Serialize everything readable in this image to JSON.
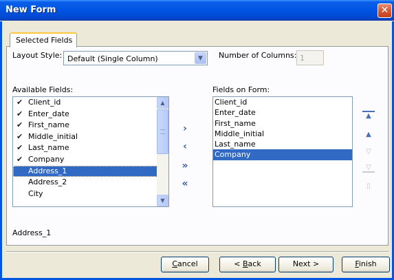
{
  "window": {
    "title": "New Form",
    "close_glyph": "✕"
  },
  "tabs": [
    {
      "label": "Selected Fields"
    }
  ],
  "layout_style": {
    "label": "Layout Style:",
    "value": "Default (Single Column)"
  },
  "number_of_columns": {
    "label": "Number of Columns:",
    "value": "1"
  },
  "available_fields": {
    "label": "Available Fields:",
    "items": [
      {
        "label": "Client_id",
        "checked": true
      },
      {
        "label": "Enter_date",
        "checked": true
      },
      {
        "label": "First_name",
        "checked": true
      },
      {
        "label": "Middle_initial",
        "checked": true
      },
      {
        "label": "Last_name",
        "checked": true
      },
      {
        "label": "Company",
        "checked": true
      },
      {
        "label": "Address_1",
        "checked": false,
        "selected": true
      },
      {
        "label": "Address_2",
        "checked": false
      },
      {
        "label": "City",
        "checked": false
      }
    ]
  },
  "fields_on_form": {
    "label": "Fields on Form:",
    "items": [
      {
        "label": "Client_id"
      },
      {
        "label": "Enter_date"
      },
      {
        "label": "First_name"
      },
      {
        "label": "Middle_initial"
      },
      {
        "label": "Last_name"
      },
      {
        "label": "Company",
        "selected": true
      }
    ]
  },
  "move_buttons": {
    "add": "›",
    "remove": "‹",
    "add_all": "»",
    "remove_all": "«"
  },
  "order_buttons": {
    "top": "▲",
    "up": "▲",
    "down": "▽",
    "bottom": "▽",
    "delete": "▯"
  },
  "status_text": "Address_1",
  "footer": {
    "cancel_pre": "",
    "cancel_key": "C",
    "cancel_post": "ancel",
    "back_pre": "< ",
    "back_key": "B",
    "back_post": "ack",
    "next_label": "Next >",
    "finish_pre": "",
    "finish_key": "F",
    "finish_post": "inish"
  },
  "colors": {
    "selection": "#316ac5",
    "titlebar": "#0054e3",
    "tab_accent": "#ffc83c"
  }
}
